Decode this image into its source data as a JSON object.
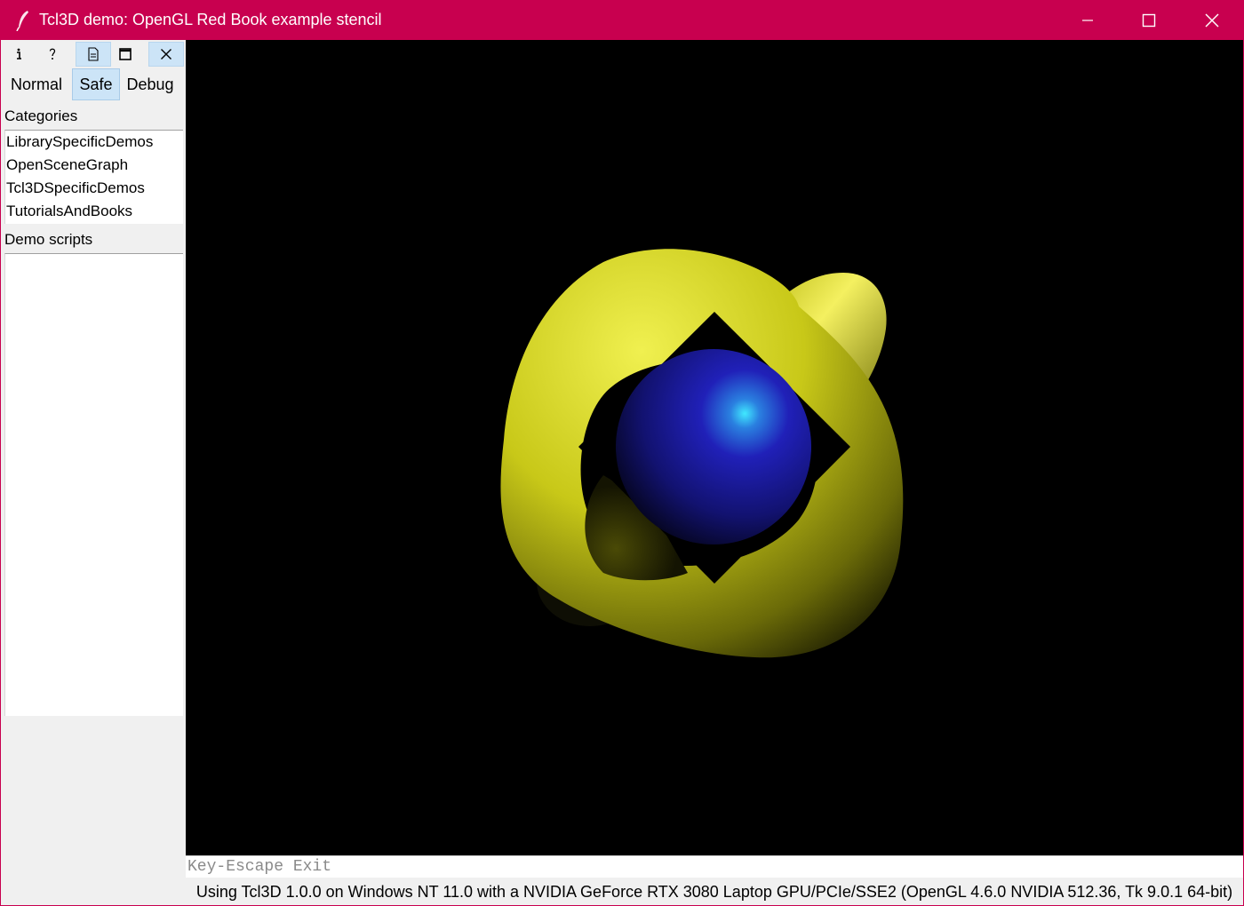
{
  "window": {
    "title": "Tcl3D demo: OpenGL Red Book example stencil",
    "accent_color": "#c8004f"
  },
  "toolbar": {
    "icons": [
      "info-icon",
      "help-icon",
      "document-icon",
      "maximize-icon",
      "close-icon"
    ],
    "active_icon": "document-icon"
  },
  "modes": {
    "items": [
      "Normal",
      "Safe",
      "Debug"
    ],
    "selected": "Safe"
  },
  "categories": {
    "label": "Categories",
    "items": [
      "LibrarySpecificDemos",
      "OpenSceneGraph",
      "Tcl3DSpecificDemos",
      "TutorialsAndBooks"
    ]
  },
  "demo_scripts": {
    "label": "Demo scripts",
    "items": []
  },
  "canvas": {
    "background": "#000000",
    "scene_colors": {
      "torus": "#d8d820",
      "sphere": "#1a1aa0",
      "highlight": "#30d0ff"
    }
  },
  "info_line": "Key-Escape Exit",
  "status_line": "Using Tcl3D 1.0.0 on Windows NT 11.0 with a NVIDIA GeForce RTX 3080 Laptop GPU/PCIe/SSE2 (OpenGL 4.6.0 NVIDIA 512.36, Tk 9.0.1 64-bit)"
}
